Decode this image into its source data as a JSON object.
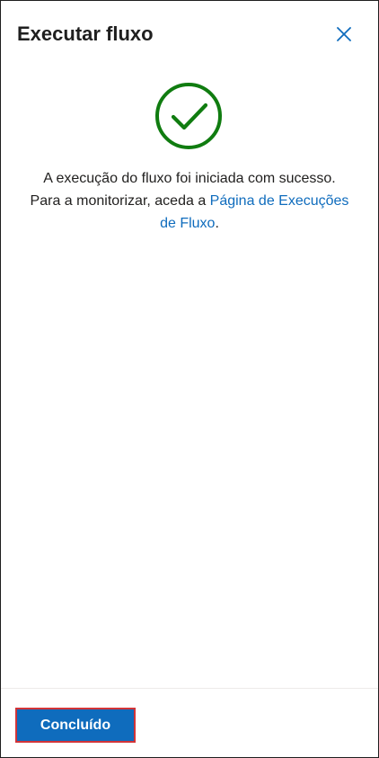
{
  "dialog": {
    "title": "Executar fluxo",
    "close_icon": "close-icon"
  },
  "status": {
    "icon": "checkmark-circle-icon",
    "color": "#107c10",
    "message_line_1": "A execução do fluxo foi iniciada com sucesso.",
    "message_line_2_prefix": "Para a monitorizar, aceda a ",
    "link_text": "Página de Execuções de Fluxo",
    "message_suffix": "."
  },
  "footer": {
    "done_label": "Concluído"
  },
  "colors": {
    "accent": "#0f6cbd",
    "focus_outline": "#d13438",
    "success": "#107c10",
    "text": "#201f1e"
  }
}
